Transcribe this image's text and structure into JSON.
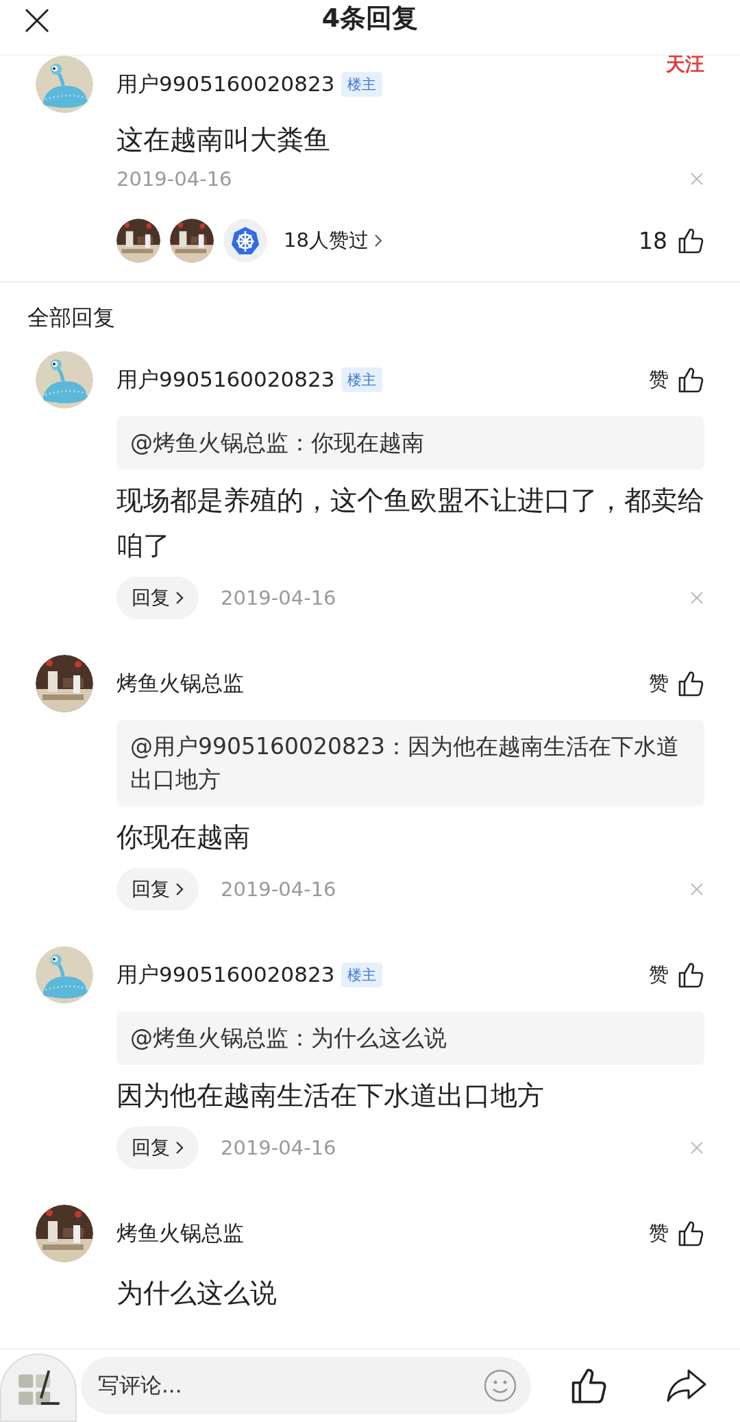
{
  "header": {
    "title": "4条回复"
  },
  "main_comment": {
    "author": "用户9905160020823",
    "op_badge": "楼主",
    "avatar": {
      "kind": "monster"
    },
    "follow": "天汪",
    "content": "这在越南叫大粪鱼",
    "date": "2019-04-16",
    "likers": [
      {
        "kind": "picture"
      },
      {
        "kind": "picture"
      },
      {
        "kind": "helm"
      }
    ],
    "likers_label": "18人赞过",
    "like_count": "18"
  },
  "section_title": "全部回复",
  "replies": [
    {
      "author": "用户9905160020823",
      "op_badge": "楼主",
      "avatar": {
        "kind": "monster"
      },
      "like_label": "赞",
      "quote": "@烤鱼火锅总监：你现在越南",
      "content": "现场都是养殖的，这个鱼欧盟不让进口了，都卖给咱了",
      "reply_button": "回复",
      "date": "2019-04-16"
    },
    {
      "author": "烤鱼火锅总监",
      "avatar": {
        "kind": "picture"
      },
      "like_label": "赞",
      "quote": "@用户9905160020823：因为他在越南生活在下水道出口地方",
      "content": "你现在越南",
      "reply_button": "回复",
      "date": "2019-04-16"
    },
    {
      "author": "用户9905160020823",
      "op_badge": "楼主",
      "avatar": {
        "kind": "monster"
      },
      "like_label": "赞",
      "quote": "@烤鱼火锅总监：为什么这么说",
      "content": "因为他在越南生活在下水道出口地方",
      "reply_button": "回复",
      "date": "2019-04-16"
    },
    {
      "author": "烤鱼火锅总监",
      "avatar": {
        "kind": "picture"
      },
      "like_label": "赞",
      "content": "为什么这么说"
    }
  ],
  "bottom_bar": {
    "placeholder": "写评论..."
  }
}
